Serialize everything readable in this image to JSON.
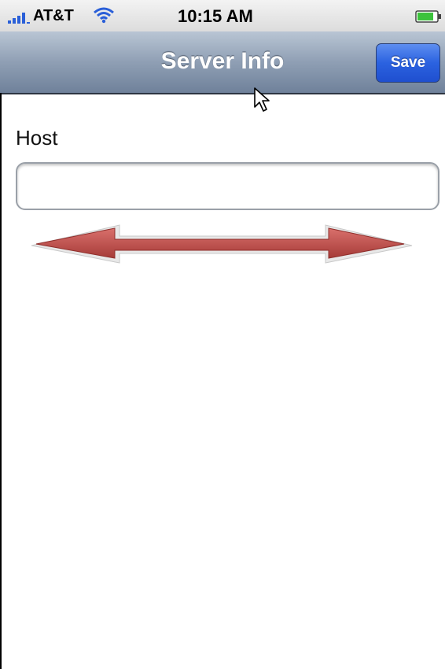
{
  "status_bar": {
    "carrier": "AT&T",
    "time": "10:15 AM",
    "signal_icon": "signal-bars-icon",
    "wifi_icon": "wifi-icon",
    "battery_icon": "battery-charging-icon"
  },
  "nav_bar": {
    "title": "Server Info",
    "save_label": "Save"
  },
  "form": {
    "host_label": "Host",
    "host_value": "",
    "host_placeholder": ""
  },
  "annotation": {
    "icon": "double-headed-arrow-icon",
    "color": "#c0504d"
  },
  "colors": {
    "nav_gradient_top": "#b9c5d4",
    "nav_gradient_bottom": "#6f819a",
    "save_button": "#2b62e0"
  }
}
